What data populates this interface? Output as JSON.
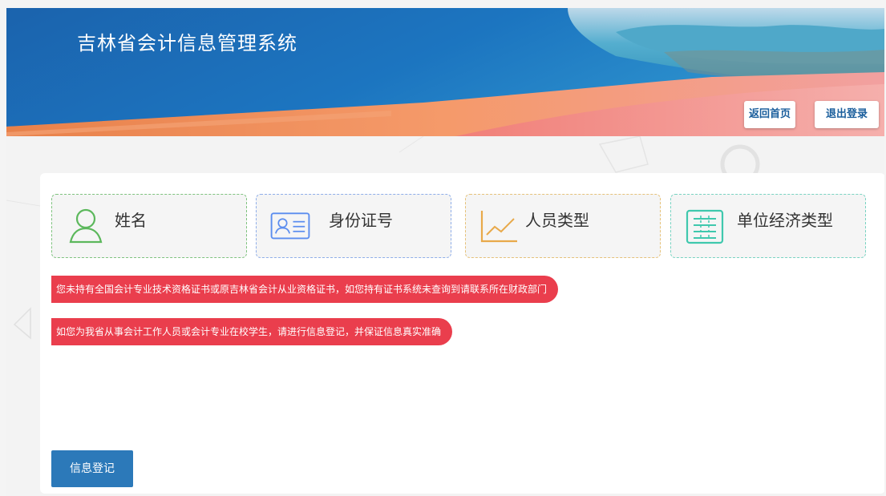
{
  "header": {
    "title": "吉林省会计信息管理系统",
    "home_label": "返回首页",
    "logout_label": "退出登录"
  },
  "info_cards": [
    {
      "label": "姓名",
      "icon": "person-icon",
      "color": "#5cb85c"
    },
    {
      "label": "身份证号",
      "icon": "id-card-icon",
      "color": "#5b8def"
    },
    {
      "label": "人员类型",
      "icon": "line-chart-icon",
      "color": "#e8a94a"
    },
    {
      "label": "单位经济类型",
      "icon": "table-icon",
      "color": "#3fc8ad"
    }
  ],
  "notices": [
    "您未持有全国会计专业技术资格证书或原吉林省会计从业资格证书，如您持有证书系统未查询到请联系所在财政部门",
    "如您为我省从事会计工作人员或会计专业在校学生，请进行信息登记，并保证信息真实准确"
  ],
  "register_label": "信息登记",
  "colors": {
    "header_blue": "#1f6fb5",
    "accent_orange": "#f08a5d",
    "notice_red": "#ea3e4d",
    "button_blue": "#2c79b9"
  }
}
